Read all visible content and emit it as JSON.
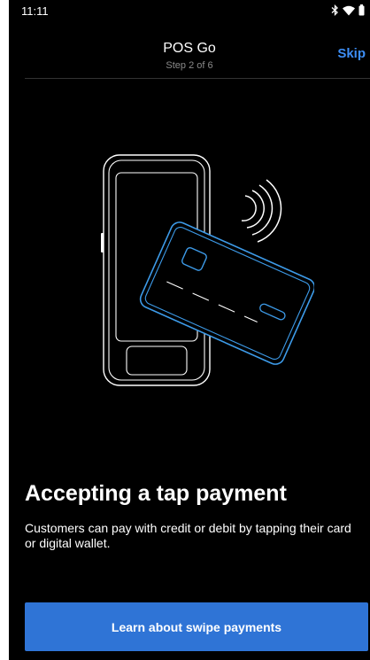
{
  "status_bar": {
    "time": "11:11",
    "icons": [
      "bluetooth-icon",
      "wifi-icon",
      "battery-icon"
    ]
  },
  "header": {
    "title": "POS Go",
    "subtitle": "Step 2 of 6",
    "skip_label": "Skip"
  },
  "illustration": {
    "description_icon": "tap-to-pay-card-phone-icon"
  },
  "content": {
    "headline": "Accepting a tap payment",
    "description": "Customers can pay with credit or debit by tapping their card or digital wallet."
  },
  "actions": {
    "primary_label": "Learn about swipe payments"
  },
  "colors": {
    "background": "#000000",
    "accent": "#3d8ef5",
    "button": "#2f74d6",
    "card_outline": "#3d9be9",
    "subtitle": "#8a8a8a"
  }
}
